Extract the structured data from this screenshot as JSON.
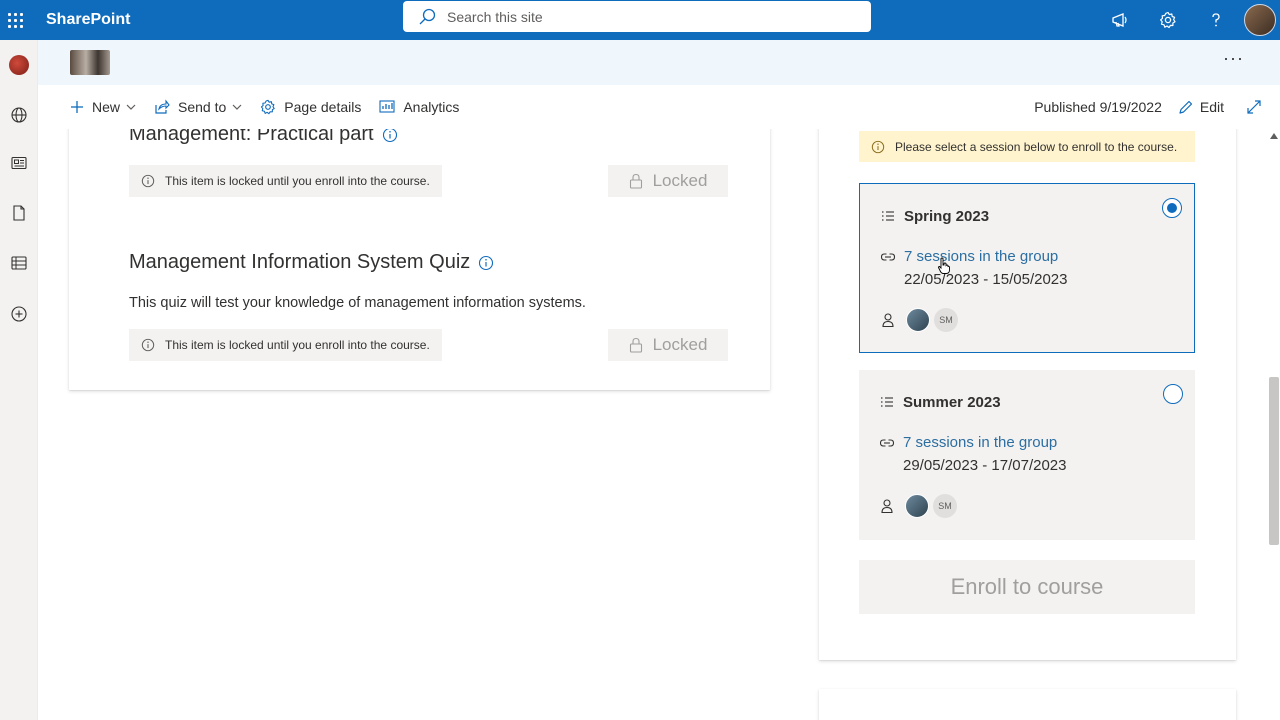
{
  "suite": {
    "brand": "SharePoint",
    "search_placeholder": "Search this site"
  },
  "command_bar": {
    "new_label": "New",
    "send_to_label": "Send to",
    "page_details_label": "Page details",
    "analytics_label": "Analytics",
    "published_label": "Published 9/19/2022",
    "edit_label": "Edit"
  },
  "course_items": [
    {
      "title": "Management: Practical part",
      "locked_note": "This item is locked until you enroll into the course.",
      "locked_label": "Locked"
    },
    {
      "title": "Management Information System Quiz",
      "description": "This quiz will test your knowledge of management information systems.",
      "locked_note": "This item is locked until you enroll into the course.",
      "locked_label": "Locked"
    }
  ],
  "enrollment": {
    "warning": "Please select a session below to enroll to the course.",
    "sessions": [
      {
        "title": "Spring 2023",
        "link": "7 sessions in the group",
        "dates": "22/05/2023 - 15/05/2023",
        "initials": "SM",
        "selected": true
      },
      {
        "title": "Summer 2023",
        "link": "7 sessions in the group",
        "dates": "29/05/2023 - 17/07/2023",
        "initials": "SM",
        "selected": false
      }
    ],
    "enroll_label": "Enroll to course"
  },
  "colors": {
    "suite_blue": "#0f6cbd",
    "warning_bg": "#fff4ce",
    "link_blue": "#2b6ea1"
  }
}
